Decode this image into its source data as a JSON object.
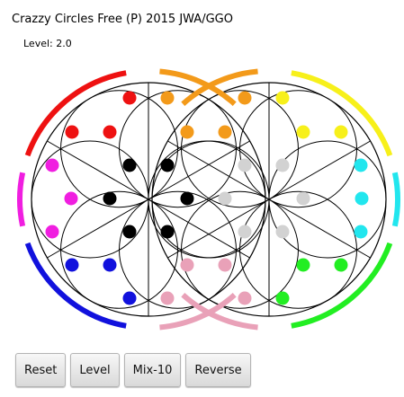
{
  "app": {
    "title": "Crazzy Circles Free (P) 2015 JWA/GGO",
    "level_text": "Level: 2.0"
  },
  "colors": {
    "red": "#ee1111",
    "orange": "#f39a1a",
    "yellow": "#f7f01a",
    "cyan": "#22e6ee",
    "green": "#22ee22",
    "pink": "#e9a1b8",
    "blue": "#1111dd",
    "magenta": "#f01ee0",
    "black": "#000000",
    "gray": "#d2d2d2",
    "outline": "#000000"
  },
  "board": {
    "arcs": [
      {
        "side": "top-left",
        "color": "red"
      },
      {
        "side": "top-center",
        "color": "orange"
      },
      {
        "side": "top-right",
        "color": "yellow"
      },
      {
        "side": "right",
        "color": "cyan"
      },
      {
        "side": "bottom-right",
        "color": "green"
      },
      {
        "side": "bottom-center",
        "color": "pink"
      },
      {
        "side": "bottom-left",
        "color": "blue"
      },
      {
        "side": "left",
        "color": "magenta"
      }
    ],
    "dots": [
      {
        "row": 0,
        "col": 0,
        "color": "red"
      },
      {
        "row": 0,
        "col": 1,
        "color": "orange"
      },
      {
        "row": 0,
        "col": 2,
        "color": "orange"
      },
      {
        "row": 0,
        "col": 3,
        "color": "yellow"
      },
      {
        "row": 1,
        "col": 0,
        "color": "red"
      },
      {
        "row": 1,
        "col": 1,
        "color": "red"
      },
      {
        "row": 1,
        "col": 2,
        "color": "orange"
      },
      {
        "row": 1,
        "col": 3,
        "color": "orange"
      },
      {
        "row": 1,
        "col": 4,
        "color": "yellow"
      },
      {
        "row": 1,
        "col": 5,
        "color": "yellow"
      },
      {
        "row": 2,
        "col": 0,
        "color": "magenta"
      },
      {
        "row": 2,
        "col": 1,
        "color": "black"
      },
      {
        "row": 2,
        "col": 2,
        "color": "black"
      },
      {
        "row": 2,
        "col": 3,
        "color": "gray"
      },
      {
        "row": 2,
        "col": 4,
        "color": "gray"
      },
      {
        "row": 2,
        "col": 5,
        "color": "cyan"
      },
      {
        "row": 3,
        "col": 0,
        "color": "magenta"
      },
      {
        "row": 3,
        "col": 1,
        "color": "black"
      },
      {
        "row": 3,
        "col": 2,
        "color": "black"
      },
      {
        "row": 3,
        "col": 3,
        "color": "gray"
      },
      {
        "row": 3,
        "col": 4,
        "color": "gray"
      },
      {
        "row": 3,
        "col": 5,
        "color": "cyan"
      },
      {
        "row": 4,
        "col": 0,
        "color": "magenta"
      },
      {
        "row": 4,
        "col": 1,
        "color": "black"
      },
      {
        "row": 4,
        "col": 2,
        "color": "black"
      },
      {
        "row": 4,
        "col": 3,
        "color": "gray"
      },
      {
        "row": 4,
        "col": 4,
        "color": "gray"
      },
      {
        "row": 4,
        "col": 5,
        "color": "cyan"
      },
      {
        "row": 5,
        "col": 0,
        "color": "blue"
      },
      {
        "row": 5,
        "col": 1,
        "color": "blue"
      },
      {
        "row": 5,
        "col": 2,
        "color": "pink"
      },
      {
        "row": 5,
        "col": 3,
        "color": "pink"
      },
      {
        "row": 5,
        "col": 4,
        "color": "green"
      },
      {
        "row": 5,
        "col": 5,
        "color": "green"
      },
      {
        "row": 6,
        "col": 0,
        "color": "blue"
      },
      {
        "row": 6,
        "col": 1,
        "color": "pink"
      },
      {
        "row": 6,
        "col": 2,
        "color": "pink"
      },
      {
        "row": 6,
        "col": 3,
        "color": "green"
      }
    ]
  },
  "toolbar": {
    "buttons": [
      {
        "id": "reset",
        "label": "Reset"
      },
      {
        "id": "level",
        "label": "Level"
      },
      {
        "id": "mix",
        "label": "Mix-10"
      },
      {
        "id": "reverse",
        "label": "Reverse"
      }
    ]
  }
}
